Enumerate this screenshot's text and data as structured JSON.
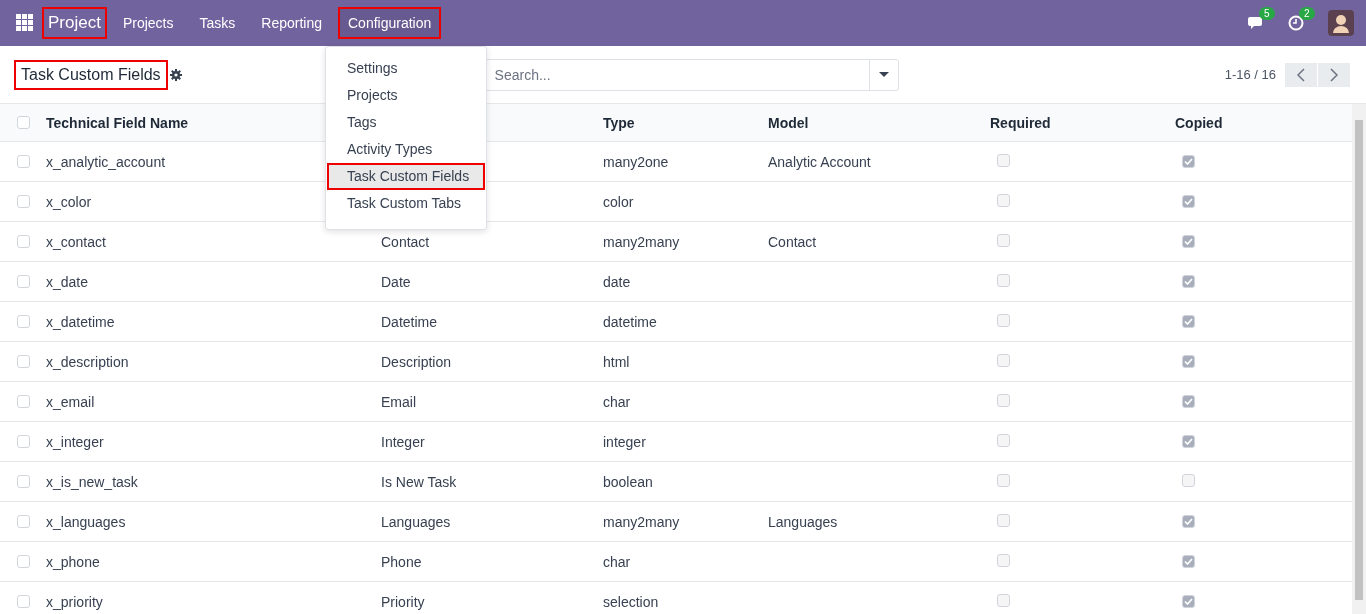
{
  "navbar": {
    "app": {
      "label": "Project",
      "highlighted": true
    },
    "menus": [
      {
        "label": "Projects",
        "open": false,
        "highlighted": false
      },
      {
        "label": "Tasks",
        "open": false,
        "highlighted": false
      },
      {
        "label": "Reporting",
        "open": false,
        "highlighted": false
      },
      {
        "label": "Configuration",
        "open": true,
        "highlighted": true
      }
    ],
    "messages_count": "5",
    "activities_count": "2"
  },
  "dropdown": {
    "items": [
      {
        "label": "Settings",
        "highlighted": false
      },
      {
        "label": "Projects",
        "highlighted": false
      },
      {
        "label": "Tags",
        "highlighted": false
      },
      {
        "label": "Activity Types",
        "highlighted": false
      },
      {
        "label": "Task Custom Fields",
        "highlighted": true
      },
      {
        "label": "Task Custom Tabs",
        "highlighted": false
      }
    ]
  },
  "control_panel": {
    "title": "Task Custom Fields",
    "title_highlighted": true,
    "search": {
      "placeholder": "Search..."
    },
    "pager": "1-16 / 16"
  },
  "table": {
    "select_all_checked": false,
    "columns": [
      "Technical Field Name",
      "",
      "Type",
      "Model",
      "Required",
      "Copied"
    ],
    "rows": [
      {
        "name": "x_analytic_account",
        "label": "",
        "type": "many2one",
        "model": "Analytic Account",
        "required": false,
        "copied": true,
        "selected": false
      },
      {
        "name": "x_color",
        "label": "",
        "type": "color",
        "model": "",
        "required": false,
        "copied": true,
        "selected": false
      },
      {
        "name": "x_contact",
        "label": "Contact",
        "type": "many2many",
        "model": "Contact",
        "required": false,
        "copied": true,
        "selected": false
      },
      {
        "name": "x_date",
        "label": "Date",
        "type": "date",
        "model": "",
        "required": false,
        "copied": true,
        "selected": false
      },
      {
        "name": "x_datetime",
        "label": "Datetime",
        "type": "datetime",
        "model": "",
        "required": false,
        "copied": true,
        "selected": false
      },
      {
        "name": "x_description",
        "label": "Description",
        "type": "html",
        "model": "",
        "required": false,
        "copied": true,
        "selected": false
      },
      {
        "name": "x_email",
        "label": "Email",
        "type": "char",
        "model": "",
        "required": false,
        "copied": true,
        "selected": false
      },
      {
        "name": "x_integer",
        "label": "Integer",
        "type": "integer",
        "model": "",
        "required": false,
        "copied": true,
        "selected": false
      },
      {
        "name": "x_is_new_task",
        "label": "Is New Task",
        "type": "boolean",
        "model": "",
        "required": false,
        "copied": false,
        "selected": false
      },
      {
        "name": "x_languages",
        "label": "Languages",
        "type": "many2many",
        "model": "Languages",
        "required": false,
        "copied": true,
        "selected": false
      },
      {
        "name": "x_phone",
        "label": "Phone",
        "type": "char",
        "model": "",
        "required": false,
        "copied": true,
        "selected": false
      },
      {
        "name": "x_priority",
        "label": "Priority",
        "type": "selection",
        "model": "",
        "required": false,
        "copied": true,
        "selected": false
      }
    ]
  }
}
